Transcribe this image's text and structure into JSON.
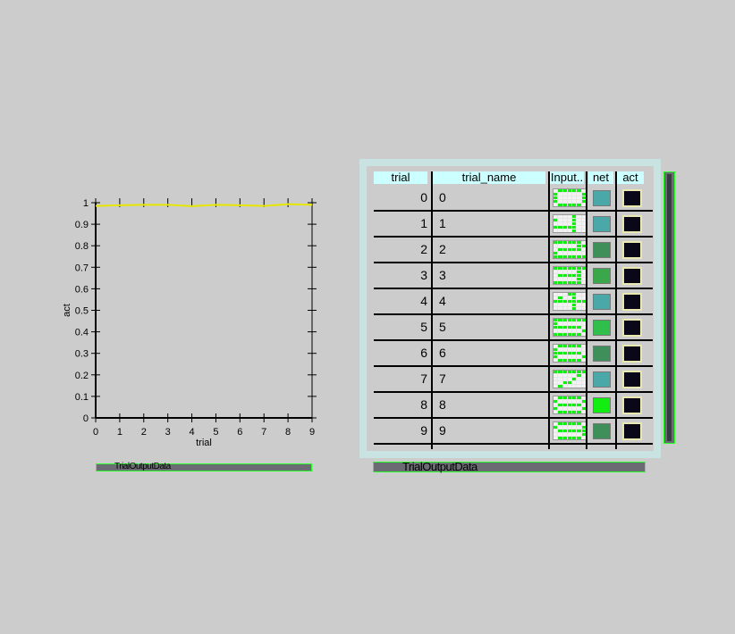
{
  "chart_data": {
    "type": "line",
    "xlabel": "trial",
    "ylabel": "act",
    "xlim": [
      0,
      9
    ],
    "ylim": [
      0,
      1
    ],
    "x_ticks": [
      "0",
      "1",
      "2",
      "3",
      "4",
      "5",
      "6",
      "7",
      "8",
      "9"
    ],
    "y_ticks": [
      "0",
      "0.1",
      "0.2",
      "0.3",
      "0.4",
      "0.5",
      "0.6",
      "0.7",
      "0.8",
      "0.9",
      "1"
    ],
    "series": [
      {
        "color": "#e6e600",
        "x": [
          0,
          1,
          2,
          3,
          4,
          5,
          6,
          7,
          8,
          9
        ],
        "y": [
          0.985,
          0.988,
          0.99,
          0.99,
          0.984,
          0.99,
          0.988,
          0.985,
          0.993,
          0.99
        ]
      }
    ]
  },
  "graph_label": "TrialOutputData",
  "grid": {
    "label": "TrialOutputData",
    "columns": [
      "trial",
      "trial_name",
      "Input..",
      "net",
      "act"
    ],
    "net_colors": [
      "#4aa8a8",
      "#4aa8a8",
      "#3f8f5a",
      "#3aa84a",
      "#4aa8a8",
      "#2fbf4a",
      "#3f8f5a",
      "#4aa8a8",
      "#12ee12",
      "#3f8f5a"
    ],
    "rows": [
      {
        "trial": "0",
        "name": "0",
        "input": [
          0,
          1,
          1,
          1,
          1,
          1,
          0,
          1,
          0,
          0,
          0,
          0,
          0,
          1,
          1,
          0,
          0,
          0,
          0,
          0,
          1,
          1,
          0,
          0,
          0,
          0,
          0,
          1,
          0,
          1,
          1,
          1,
          1,
          1,
          0
        ]
      },
      {
        "trial": "1",
        "name": "1",
        "input": [
          0,
          0,
          0,
          0,
          1,
          0,
          0,
          1,
          0,
          0,
          0,
          1,
          0,
          0,
          0,
          0,
          0,
          0,
          1,
          0,
          0,
          1,
          1,
          1,
          1,
          1,
          0,
          0,
          0,
          0,
          0,
          0,
          1,
          0,
          0
        ]
      },
      {
        "trial": "2",
        "name": "2",
        "input": [
          1,
          1,
          1,
          1,
          1,
          1,
          0,
          0,
          0,
          0,
          0,
          0,
          1,
          1,
          0,
          1,
          1,
          1,
          1,
          1,
          0,
          1,
          0,
          0,
          0,
          0,
          0,
          0,
          1,
          1,
          1,
          1,
          1,
          1,
          1
        ]
      },
      {
        "trial": "3",
        "name": "3",
        "input": [
          1,
          1,
          1,
          1,
          1,
          1,
          1,
          0,
          0,
          0,
          0,
          0,
          1,
          0,
          0,
          1,
          1,
          1,
          1,
          1,
          0,
          0,
          0,
          0,
          0,
          0,
          1,
          0,
          1,
          1,
          1,
          1,
          1,
          1,
          0
        ]
      },
      {
        "trial": "4",
        "name": "4",
        "input": [
          0,
          0,
          0,
          1,
          1,
          0,
          0,
          0,
          1,
          0,
          0,
          1,
          0,
          0,
          1,
          1,
          1,
          1,
          1,
          1,
          1,
          0,
          0,
          0,
          0,
          1,
          0,
          0,
          0,
          0,
          0,
          0,
          1,
          0,
          0
        ]
      },
      {
        "trial": "5",
        "name": "5",
        "input": [
          1,
          1,
          1,
          1,
          1,
          1,
          1,
          1,
          0,
          0,
          0,
          0,
          0,
          0,
          1,
          1,
          1,
          1,
          1,
          1,
          0,
          0,
          0,
          0,
          0,
          0,
          0,
          1,
          1,
          1,
          1,
          1,
          1,
          1,
          0
        ]
      },
      {
        "trial": "6",
        "name": "6",
        "input": [
          0,
          1,
          1,
          1,
          1,
          1,
          0,
          1,
          0,
          0,
          0,
          0,
          0,
          0,
          1,
          1,
          1,
          1,
          1,
          1,
          0,
          1,
          0,
          0,
          0,
          0,
          0,
          1,
          0,
          1,
          1,
          1,
          1,
          1,
          0
        ]
      },
      {
        "trial": "7",
        "name": "7",
        "input": [
          1,
          1,
          1,
          1,
          1,
          1,
          1,
          0,
          0,
          0,
          0,
          0,
          1,
          0,
          0,
          0,
          0,
          0,
          1,
          0,
          0,
          0,
          0,
          1,
          1,
          0,
          0,
          0,
          0,
          1,
          0,
          0,
          0,
          0,
          0
        ]
      },
      {
        "trial": "8",
        "name": "8",
        "input": [
          0,
          1,
          1,
          1,
          1,
          1,
          0,
          1,
          0,
          0,
          0,
          0,
          0,
          1,
          0,
          1,
          1,
          1,
          1,
          1,
          0,
          1,
          0,
          0,
          0,
          0,
          0,
          1,
          0,
          1,
          1,
          1,
          1,
          1,
          0
        ]
      },
      {
        "trial": "9",
        "name": "9",
        "input": [
          0,
          1,
          1,
          1,
          1,
          1,
          0,
          1,
          0,
          0,
          0,
          0,
          0,
          1,
          0,
          1,
          1,
          1,
          1,
          1,
          1,
          0,
          0,
          0,
          0,
          0,
          0,
          1,
          0,
          1,
          1,
          1,
          1,
          1,
          0
        ]
      }
    ]
  }
}
